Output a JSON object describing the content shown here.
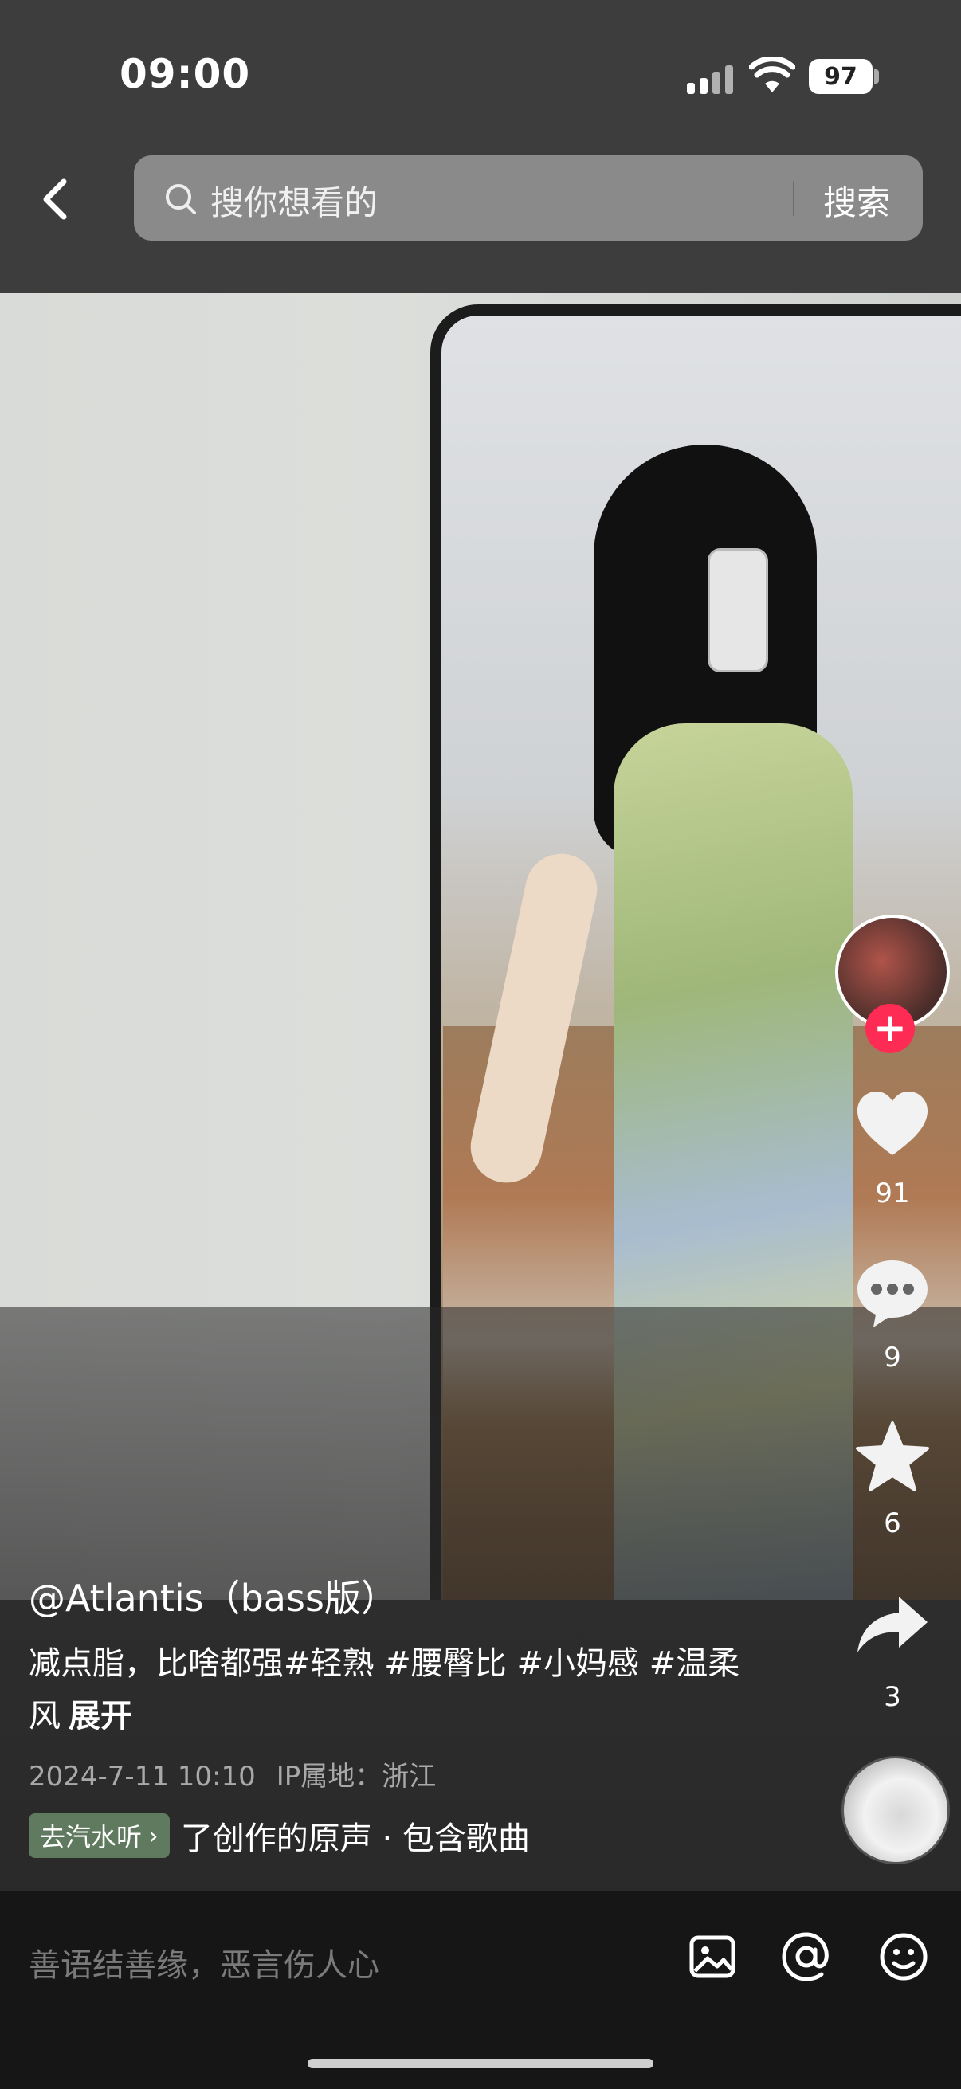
{
  "status_bar": {
    "time": "09:00",
    "battery": "97"
  },
  "search": {
    "placeholder": "搜你想看的",
    "button": "搜索"
  },
  "video": {
    "music_title": "@Atlantis（bass版）",
    "caption": "减点脂，比啥都强#轻熟 #腰臀比 #小妈感 #温柔风",
    "caption_more": "展开",
    "date": "2024-7-11 10:10",
    "ip_location": "IP属地：浙江",
    "music_tag": "去汽水听",
    "music_text": "了创作的原声 · 包含歌曲"
  },
  "actions": {
    "like_count": "91",
    "comment_count": "9",
    "favorite_count": "6",
    "share_count": "3"
  },
  "comment_bar": {
    "placeholder": "善语结善缘，恶言伤人心"
  },
  "colors": {
    "follow": "#fe2c55",
    "music_tag": "#5f7a5e",
    "search_box": "#8a8a8a"
  }
}
